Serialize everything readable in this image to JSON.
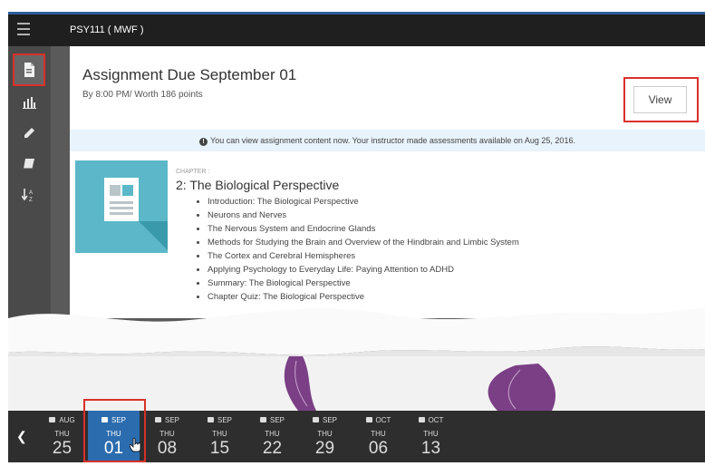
{
  "header": {
    "course_title": "PSY111 ( MWF )"
  },
  "sidebar": {
    "items": [
      {
        "icon": "document-icon",
        "active": true
      },
      {
        "icon": "bar-chart-icon",
        "active": false
      },
      {
        "icon": "pencil-icon",
        "active": false
      },
      {
        "icon": "book-icon",
        "active": false
      },
      {
        "icon": "sort-az-icon",
        "active": false
      }
    ]
  },
  "assignment": {
    "title": "Assignment Due September 01",
    "subtitle": "By 8:00 PM/ Worth 186 points",
    "view_label": "View",
    "notice": "You can view assignment content now. Your instructor made assessments available on Aug 25, 2016."
  },
  "chapter": {
    "label": "CHAPTER :",
    "title": "2: The Biological Perspective",
    "topics": [
      "Introduction: The Biological Perspective",
      "Neurons and Nerves",
      "The Nervous System and Endocrine Glands",
      "Methods for Studying the Brain and Overview of the Hindbrain and Limbic System",
      "The Cortex and Cerebral Hemispheres",
      "Applying Psychology to Everyday Life: Paying Attention to ADHD",
      "Summary: The Biological Perspective",
      "Chapter Quiz: The Biological Perspective"
    ]
  },
  "dates": [
    {
      "month": "AUG",
      "dow": "THU",
      "day": "25",
      "selected": false
    },
    {
      "month": "SEP",
      "dow": "THU",
      "day": "01",
      "selected": true
    },
    {
      "month": "SEP",
      "dow": "THU",
      "day": "08",
      "selected": false
    },
    {
      "month": "SEP",
      "dow": "THU",
      "day": "15",
      "selected": false
    },
    {
      "month": "SEP",
      "dow": "THU",
      "day": "22",
      "selected": false
    },
    {
      "month": "SEP",
      "dow": "THU",
      "day": "29",
      "selected": false
    },
    {
      "month": "OCT",
      "dow": "THU",
      "day": "06",
      "selected": false
    },
    {
      "month": "OCT",
      "dow": "THU",
      "day": "13",
      "selected": false
    }
  ],
  "colors": {
    "accent_blue": "#2b6cae",
    "highlight_red": "#d9302b",
    "topbar": "#1f1f1f",
    "notice_bg": "#e8f3fb",
    "thumb_teal": "#5cb8c8",
    "artwork_purple": "#7b3f86"
  }
}
